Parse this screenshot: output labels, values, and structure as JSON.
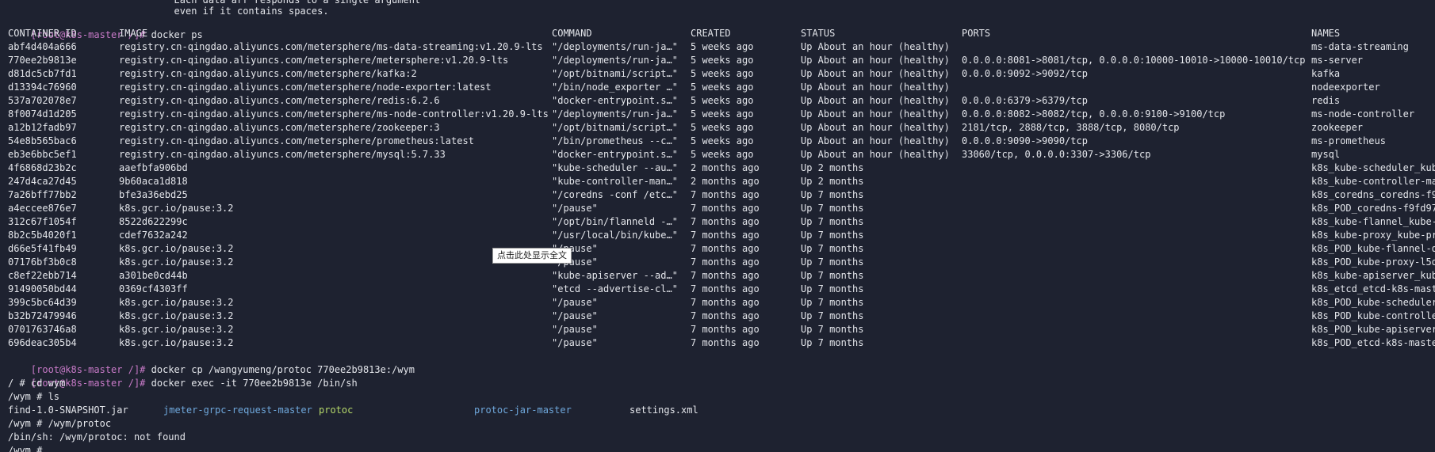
{
  "top_lines": [
    "                             Each data arr responds to a single argument",
    "                             even if it contains spaces."
  ],
  "prompt": {
    "user_host": "[root@k8s-master /]#"
  },
  "command_ps": "docker ps",
  "ps_headers": [
    "CONTAINER ID",
    "IMAGE",
    "COMMAND",
    "CREATED",
    "STATUS",
    "PORTS",
    "NAMES"
  ],
  "ps_rows": [
    [
      "abf4d404a666",
      "registry.cn-qingdao.aliyuncs.com/metersphere/ms-data-streaming:v1.20.9-lts",
      "\"/deployments/run-ja…\"",
      "5 weeks ago",
      "Up About an hour (healthy)",
      "",
      "ms-data-streaming"
    ],
    [
      "770ee2b9813e",
      "registry.cn-qingdao.aliyuncs.com/metersphere/metersphere:v1.20.9-lts",
      "\"/deployments/run-ja…\"",
      "5 weeks ago",
      "Up About an hour (healthy)",
      "0.0.0.0:8081->8081/tcp, 0.0.0.0:10000-10010->10000-10010/tcp",
      "ms-server"
    ],
    [
      "d81dc5cb7fd1",
      "registry.cn-qingdao.aliyuncs.com/metersphere/kafka:2",
      "\"/opt/bitnami/script…\"",
      "5 weeks ago",
      "Up About an hour (healthy)",
      "0.0.0.0:9092->9092/tcp",
      "kafka"
    ],
    [
      "d13394c76960",
      "registry.cn-qingdao.aliyuncs.com/metersphere/node-exporter:latest",
      "\"/bin/node_exporter …\"",
      "5 weeks ago",
      "Up About an hour (healthy)",
      "",
      "nodeexporter"
    ],
    [
      "537a702078e7",
      "registry.cn-qingdao.aliyuncs.com/metersphere/redis:6.2.6",
      "\"docker-entrypoint.s…\"",
      "5 weeks ago",
      "Up About an hour (healthy)",
      "0.0.0.0:6379->6379/tcp",
      "redis"
    ],
    [
      "8f0074d1d205",
      "registry.cn-qingdao.aliyuncs.com/metersphere/ms-node-controller:v1.20.9-lts",
      "\"/deployments/run-ja…\"",
      "5 weeks ago",
      "Up About an hour (healthy)",
      "0.0.0.0:8082->8082/tcp, 0.0.0.0:9100->9100/tcp",
      "ms-node-controller"
    ],
    [
      "a12b12fadb97",
      "registry.cn-qingdao.aliyuncs.com/metersphere/zookeeper:3",
      "\"/opt/bitnami/script…\"",
      "5 weeks ago",
      "Up About an hour (healthy)",
      "2181/tcp, 2888/tcp, 3888/tcp, 8080/tcp",
      "zookeeper"
    ],
    [
      "54e8b565bac6",
      "registry.cn-qingdao.aliyuncs.com/metersphere/prometheus:latest",
      "\"/bin/prometheus --c…\"",
      "5 weeks ago",
      "Up About an hour (healthy)",
      "0.0.0.0:9090->9090/tcp",
      "ms-prometheus"
    ],
    [
      "eb3e6bbc5ef1",
      "registry.cn-qingdao.aliyuncs.com/metersphere/mysql:5.7.33",
      "\"docker-entrypoint.s…\"",
      "5 weeks ago",
      "Up About an hour (healthy)",
      "33060/tcp, 0.0.0.0:3307->3306/tcp",
      "mysql"
    ],
    [
      "4f6868d23b2c",
      "aaefbfa906bd",
      "\"kube-scheduler --au…\"",
      "2 months ago",
      "Up 2 months",
      "",
      "k8s_kube-scheduler_kub"
    ],
    [
      "247d4ca27d45",
      "9b60aca1d818",
      "\"kube-controller-man…\"",
      "2 months ago",
      "Up 2 months",
      "",
      "k8s_kube-controller-ma"
    ],
    [
      "7a26bff77bb2",
      "bfe3a36ebd25",
      "\"/coredns -conf /etc…\"",
      "7 months ago",
      "Up 7 months",
      "",
      "k8s_coredns_coredns-f9"
    ],
    [
      "a4eccee876e7",
      "k8s.gcr.io/pause:3.2",
      "\"/pause\"",
      "7 months ago",
      "Up 7 months",
      "",
      "k8s_POD_coredns-f9fd97"
    ],
    [
      "312c67f1054f",
      "8522d622299c",
      "\"/opt/bin/flanneld -…\"",
      "7 months ago",
      "Up 7 months",
      "",
      "k8s_kube-flannel_kube-"
    ],
    [
      "8b2c5b4020f1",
      "cdef7632a242",
      "\"/usr/local/bin/kube…\"",
      "7 months ago",
      "Up 7 months",
      "",
      "k8s_kube-proxy_kube-pr"
    ],
    [
      "d66e5f41fb49",
      "k8s.gcr.io/pause:3.2",
      "\"/pause\"",
      "7 months ago",
      "Up 7 months",
      "",
      "k8s_POD_kube-flannel-d"
    ],
    [
      "07176bf3b0c8",
      "k8s.gcr.io/pause:3.2",
      "\"/pause\"",
      "7 months ago",
      "Up 7 months",
      "",
      "k8s_POD_kube-proxy-l5d"
    ],
    [
      "c8ef22ebb714",
      "a301be0cd44b",
      "\"kube-apiserver --ad…\"",
      "7 months ago",
      "Up 7 months",
      "",
      "k8s_kube-apiserver_kub"
    ],
    [
      "91490050bd44",
      "0369cf4303ff",
      "\"etcd --advertise-cl…\"",
      "7 months ago",
      "Up 7 months",
      "",
      "k8s_etcd_etcd-k8s-mast"
    ],
    [
      "399c5bc64d39",
      "k8s.gcr.io/pause:3.2",
      "\"/pause\"",
      "7 months ago",
      "Up 7 months",
      "",
      "k8s_POD_kube-scheduler"
    ],
    [
      "b32b72479946",
      "k8s.gcr.io/pause:3.2",
      "\"/pause\"",
      "7 months ago",
      "Up 7 months",
      "",
      "k8s_POD_kube-controlle"
    ],
    [
      "0701763746a8",
      "k8s.gcr.io/pause:3.2",
      "\"/pause\"",
      "7 months ago",
      "Up 7 months",
      "",
      "k8s_POD_kube-apiserver"
    ],
    [
      "696deac305b4",
      "k8s.gcr.io/pause:3.2",
      "\"/pause\"",
      "7 months ago",
      "Up 7 months",
      "",
      "k8s_POD_etcd-k8s-maste"
    ]
  ],
  "command_cp": "docker cp /wangyumeng/protoc 770ee2b9813e:/wym",
  "command_exec": "docker exec -it 770ee2b9813e /bin/sh",
  "shell_lines": {
    "cd": "/ # cd wym",
    "ls": "/wym # ls",
    "run": "/wym # /wym/protoc",
    "error": "/bin/sh: /wym/protoc: not found",
    "partial": "/wym #"
  },
  "ls_entries": {
    "jar": "find-1.0-SNAPSHOT.jar",
    "dir1": "jmeter-grpc-request-master",
    "exec": "protoc",
    "dir2": "protoc-jar-master",
    "xml": "settings.xml"
  },
  "tooltip": "点击此处显示全文"
}
